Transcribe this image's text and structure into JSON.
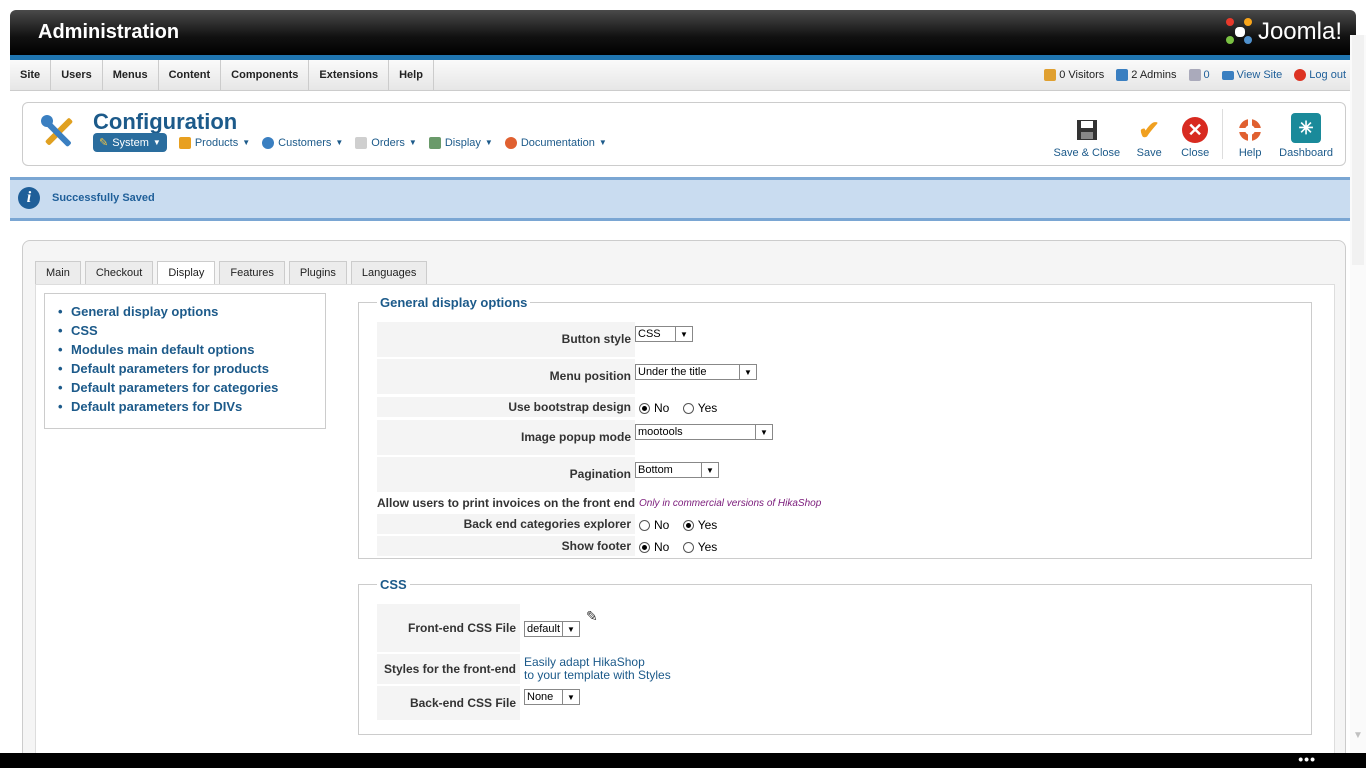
{
  "header": {
    "title": "Administration",
    "brand": "Joomla!"
  },
  "menubar": {
    "items": [
      "Site",
      "Users",
      "Menus",
      "Content",
      "Components",
      "Extensions",
      "Help"
    ]
  },
  "status": {
    "visitors": "0 Visitors",
    "admins": "2 Admins",
    "messages": "0",
    "view_site": "View Site",
    "logout": "Log out"
  },
  "page": {
    "title": "Configuration"
  },
  "submenu": [
    "System",
    "Products",
    "Customers",
    "Orders",
    "Display",
    "Documentation"
  ],
  "toolbar": {
    "save_close": "Save & Close",
    "save": "Save",
    "close": "Close",
    "help": "Help",
    "dashboard": "Dashboard"
  },
  "message": {
    "text": "Successfully Saved"
  },
  "tabs": [
    "Main",
    "Checkout",
    "Display",
    "Features",
    "Plugins",
    "Languages"
  ],
  "active_tab": "Display",
  "side_nav": [
    "General display options",
    "CSS",
    "Modules main default options",
    "Default parameters for products",
    "Default parameters for categories",
    "Default parameters for DIVs"
  ],
  "general": {
    "legend": "General display options",
    "button_style": {
      "label": "Button style",
      "value": "CSS"
    },
    "menu_position": {
      "label": "Menu position",
      "value": "Under the title"
    },
    "bootstrap": {
      "label": "Use bootstrap design",
      "no": "No",
      "yes": "Yes",
      "selected": "No"
    },
    "popup": {
      "label": "Image popup mode",
      "value": "mootools"
    },
    "pagination": {
      "label": "Pagination",
      "value": "Bottom"
    },
    "print_invoices": {
      "label": "Allow users to print invoices on the front end",
      "note": "Only in commercial versions of HikaShop"
    },
    "categories_explorer": {
      "label": "Back end categories explorer",
      "no": "No",
      "yes": "Yes",
      "selected": "Yes"
    },
    "footer": {
      "label": "Show footer",
      "no": "No",
      "yes": "Yes",
      "selected": "No"
    }
  },
  "css": {
    "legend": "CSS",
    "frontend_file": {
      "label": "Front-end CSS File",
      "value": "default"
    },
    "styles": {
      "label": "Styles for the front-end",
      "link1": "Easily adapt HikaShop",
      "link2": "to your template with Styles"
    },
    "backend_file": {
      "label": "Back-end CSS File",
      "value": "None"
    }
  },
  "colors": {
    "accent": "#1c5a8a",
    "header_stripe": "#1f75b0",
    "message_bg": "#c9dcf0"
  }
}
